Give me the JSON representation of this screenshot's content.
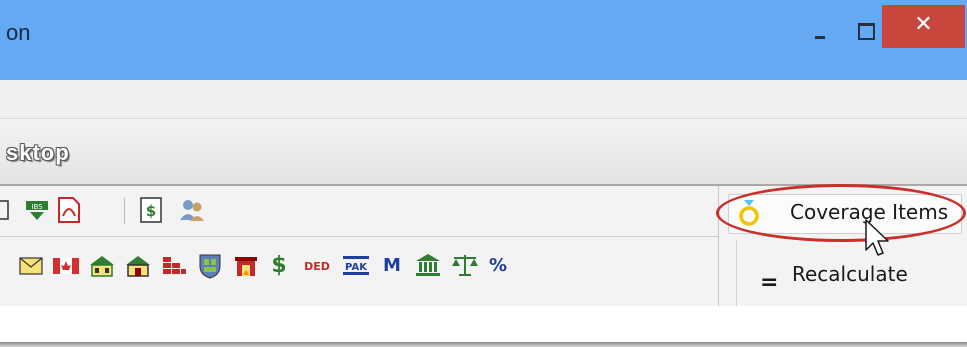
{
  "window": {
    "title_fragment": "on",
    "close_glyph": "✕"
  },
  "heading": {
    "title_fragment": "sktop"
  },
  "toolbar": {
    "row1_icons": [
      "frame-icon",
      "check-stamp-icon",
      "pdf-icon",
      "money-document-icon",
      "users-icon"
    ],
    "row2_icons": [
      "envelope-icon",
      "canada-flag-icon",
      "house-icon",
      "bricks-icon",
      "shield-icon",
      "fireplace-icon",
      "dollar-icon",
      "ded-icon",
      "pak-icon",
      "m-icon",
      "bank-icon",
      "scales-icon",
      "percent-icon"
    ],
    "labels": {
      "dollar": "$",
      "ded": "DED",
      "pak": "PAK",
      "m": "M",
      "percent": "%"
    }
  },
  "actions": {
    "coverage_items_label": "Coverage Items",
    "recalculate_label": "Recalculate",
    "recalculate_glyph": "="
  },
  "colors": {
    "title_bar": "#64a9f2",
    "close_button": "#c9463d",
    "annotation": "#c9302c"
  }
}
